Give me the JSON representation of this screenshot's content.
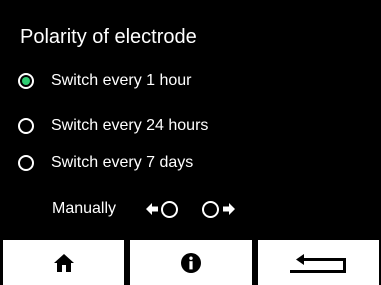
{
  "screen": {
    "title": "Polarity of electrode"
  },
  "options": [
    {
      "label": "Switch every 1 hour",
      "selected": true
    },
    {
      "label": "Switch every 24 hours",
      "selected": false
    },
    {
      "label": "Switch every 7 days",
      "selected": false
    }
  ],
  "manual": {
    "label": "Manually",
    "left_icon": "arrow-left-icon",
    "right_icon": "arrow-right-icon"
  },
  "nav": {
    "home_icon": "home-icon",
    "info_icon": "info-icon",
    "back_icon": "return-arrow-icon"
  },
  "colors": {
    "background": "#000000",
    "text": "#ffffff",
    "selected_radio": "#2ecc71",
    "nav_button": "#ffffff",
    "nav_icon": "#000000"
  }
}
